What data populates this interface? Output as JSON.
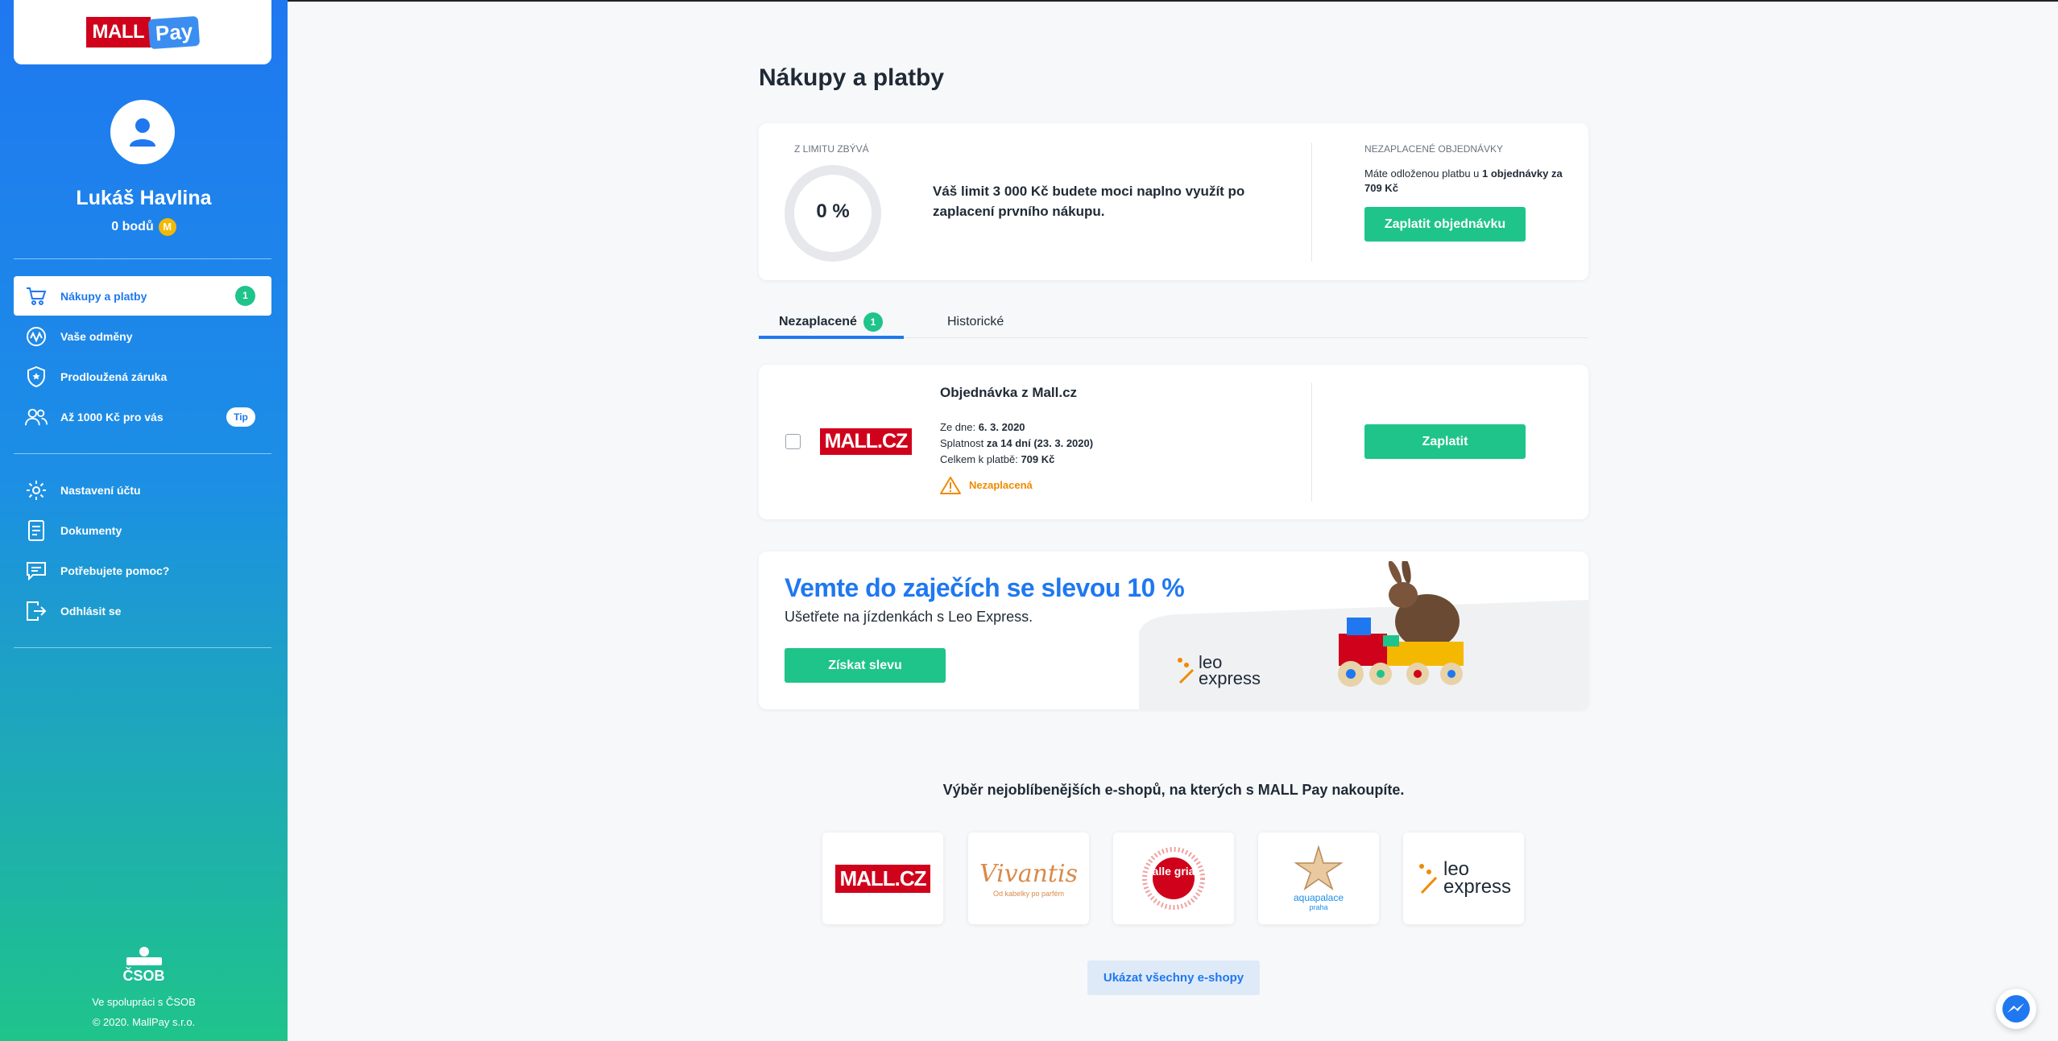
{
  "brand": {
    "mall": "MALL",
    "pay": "Pay"
  },
  "user": {
    "name": "Lukáš Havlina",
    "points": "0 bodů",
    "coin_glyph": "M"
  },
  "nav": {
    "items": [
      {
        "label": "Nákupy a platby",
        "badge": "1",
        "icon": "cart-icon"
      },
      {
        "label": "Vaše odměny",
        "icon": "rewards-icon"
      },
      {
        "label": "Prodloužená záruka",
        "icon": "shield-icon"
      },
      {
        "label": "Až 1000 Kč pro vás",
        "badge": "Tip",
        "icon": "people-icon"
      }
    ],
    "secondary": [
      {
        "label": "Nastavení účtu",
        "icon": "gear-icon"
      },
      {
        "label": "Dokumenty",
        "icon": "document-icon"
      },
      {
        "label": "Potřebujete pomoc?",
        "icon": "chat-icon"
      },
      {
        "label": "Odhlásit se",
        "icon": "logout-icon"
      }
    ]
  },
  "footer": {
    "csob": "ČSOB",
    "partner": "Ve spolupráci s ČSOB",
    "copyright": "© 2020. MallPay s.r.o."
  },
  "page": {
    "title": "Nákupy a platby"
  },
  "limit": {
    "label": "Z LIMITU ZBÝVÁ",
    "percent": "0 %",
    "percent_value": 0,
    "message": "Váš limit 3 000 Kč budete moci naplno využít po zaplacení prvního nákupu."
  },
  "unpaid": {
    "label": "NEZAPLACENÉ OBJEDNÁVKY",
    "text_prefix": "Máte odloženou platbu u ",
    "text_bold": "1 objednávky za 709 Kč",
    "button": "Zaplatit objednávku"
  },
  "tabs": [
    {
      "label": "Nezaplacené",
      "badge": "1"
    },
    {
      "label": "Historické"
    }
  ],
  "order": {
    "shop_logo": "MALL.CZ",
    "title": "Objednávka z Mall.cz",
    "date_label": "Ze dne: ",
    "date": "6. 3. 2020",
    "due_label": "Splatnost ",
    "due": "za 14 dní (23. 3. 2020)",
    "total_label": "Celkem k platbě: ",
    "total": "709 Kč",
    "status": "Nezaplacená",
    "button": "Zaplatit"
  },
  "promo": {
    "title": "Vemte do zaječích se slevou 10 %",
    "subtitle": "Ušetřete na jízdenkách s Leo Express.",
    "button": "Získat slevu",
    "brand_line1": "leo",
    "brand_line2": "express"
  },
  "shops": {
    "heading": "Výběr nejoblíbenějších e-shopů, na kterých s MALL Pay nakoupíte.",
    "items": [
      {
        "name": "MALL.CZ"
      },
      {
        "name": "Vivantis",
        "tagline": "Od kabelky po parfém"
      },
      {
        "name": "alle gria"
      },
      {
        "name": "aquapalace",
        "sub": "praha"
      },
      {
        "name": "leo express"
      }
    ],
    "show_all": "Ukázat všechny e-shopy"
  },
  "colors": {
    "primary": "#1f78f0",
    "green": "#1fc48a",
    "mall_red": "#d0021b",
    "warning": "#f08a00"
  }
}
